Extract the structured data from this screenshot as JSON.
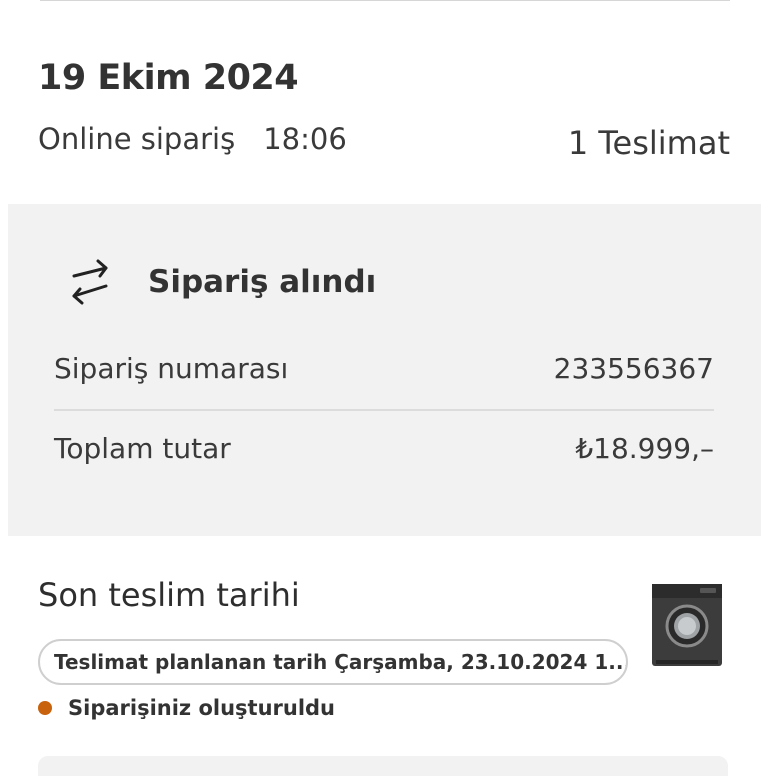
{
  "order": {
    "date": "19 Ekim 2024",
    "channel": "Online sipariş",
    "time": "18:06",
    "delivery_count": "1 Teslimat"
  },
  "status": {
    "icon": "swap-arrows-icon",
    "title": "Sipariş alındı",
    "order_number_label": "Sipariş numarası",
    "order_number_value": "233556367",
    "total_label": "Toplam tutar",
    "total_value": "₺18.999,–"
  },
  "delivery": {
    "deadline_label": "Son teslim tarihi",
    "planned_text": "Teslimat planlanan tarih Çarşamba, 23.10.2024 1...",
    "order_status": "Siparişiniz oluşturuldu",
    "status_color": "#c8620d",
    "product_image_icon": "washing-machine-icon"
  }
}
